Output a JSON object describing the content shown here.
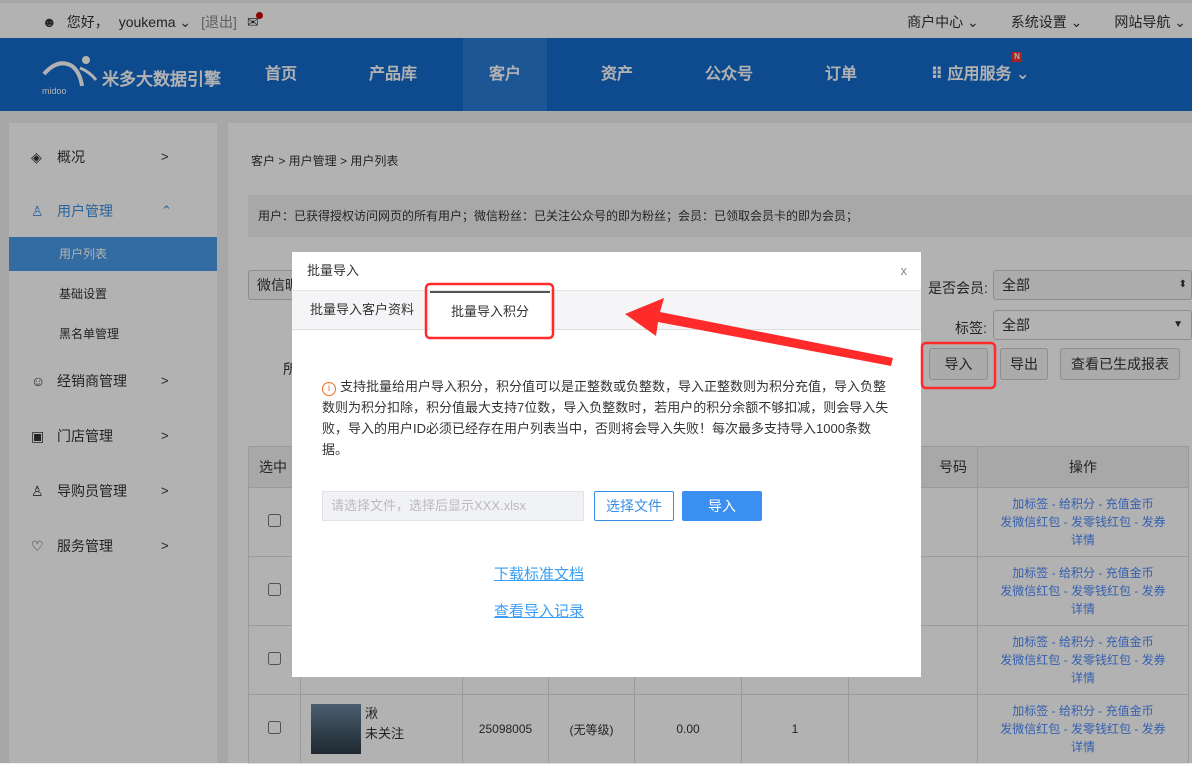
{
  "topbar": {
    "greeting": "您好，",
    "user": "youkema",
    "logout": "[退出]",
    "right": [
      "商户中心",
      "系统设置",
      "网站导航"
    ]
  },
  "nav": {
    "brand": "米多大数据引擎",
    "logo_text": "midoo米多",
    "items": [
      "首页",
      "产品库",
      "客户",
      "资产",
      "公众号",
      "订单"
    ],
    "active": "客户",
    "app_service": "应用服务",
    "badge": "N"
  },
  "sidebar": {
    "items": [
      {
        "label": "概况",
        "icon": "layers-icon"
      },
      {
        "label": "用户管理",
        "icon": "user-icon",
        "expanded": true
      },
      {
        "label": "经销商管理",
        "icon": "group-icon"
      },
      {
        "label": "门店管理",
        "icon": "store-icon"
      },
      {
        "label": "导购员管理",
        "icon": "user-icon"
      },
      {
        "label": "服务管理",
        "icon": "heart-icon"
      }
    ],
    "sub": [
      "用户列表",
      "基础设置",
      "黑名单管理"
    ],
    "active_sub": "用户列表"
  },
  "main": {
    "breadcrumb": "客户 > 用户管理 > 用户列表",
    "info": "用户：已获得授权访问网页的所有用户；微信粉丝：已关注公众号的即为粉丝；会员：已领取会员卡的即为会员；",
    "filter_left": "微信昵",
    "partial_label": "所",
    "member_label": "是否会员:",
    "member_value": "全部",
    "tag_label": "标签:",
    "tag_value": "全部",
    "buttons": [
      "导入",
      "导出",
      "查看已生成报表"
    ],
    "table": {
      "headers": [
        "选中",
        "号码",
        "操作"
      ],
      "ops": [
        "加标签",
        "给积分",
        "充值金币",
        "发微信红包",
        "发零钱红包",
        "发券",
        "详情"
      ],
      "last_row": {
        "name": "湫",
        "status": "未关注",
        "id": "25098005",
        "level": "(无等级)",
        "balance": "0.00",
        "count": "1"
      }
    }
  },
  "modal": {
    "title": "批量导入",
    "close": "x",
    "tabs": [
      "批量导入客户资料",
      "批量导入积分"
    ],
    "active_tab": "批量导入积分",
    "description": "支持批量给用户导入积分，积分值可以是正整数或负整数，导入正整数则为积分充值，导入负整数则为积分扣除，积分值最大支持7位数，导入负整数时，若用户的积分余额不够扣减，则会导入失败，导入的用户ID必须已经存在用户列表当中，否则将会导入失败！每次最多支持导入1000条数据。",
    "file_placeholder": "请选择文件，选择后显示XXX.xlsx",
    "choose_file": "选择文件",
    "import": "导入",
    "download": "下载标准文档",
    "records": "查看导入记录"
  },
  "colors": {
    "nav": "#156ccc",
    "accent": "#3b8ff0",
    "annotation": "#ff2a2a"
  }
}
